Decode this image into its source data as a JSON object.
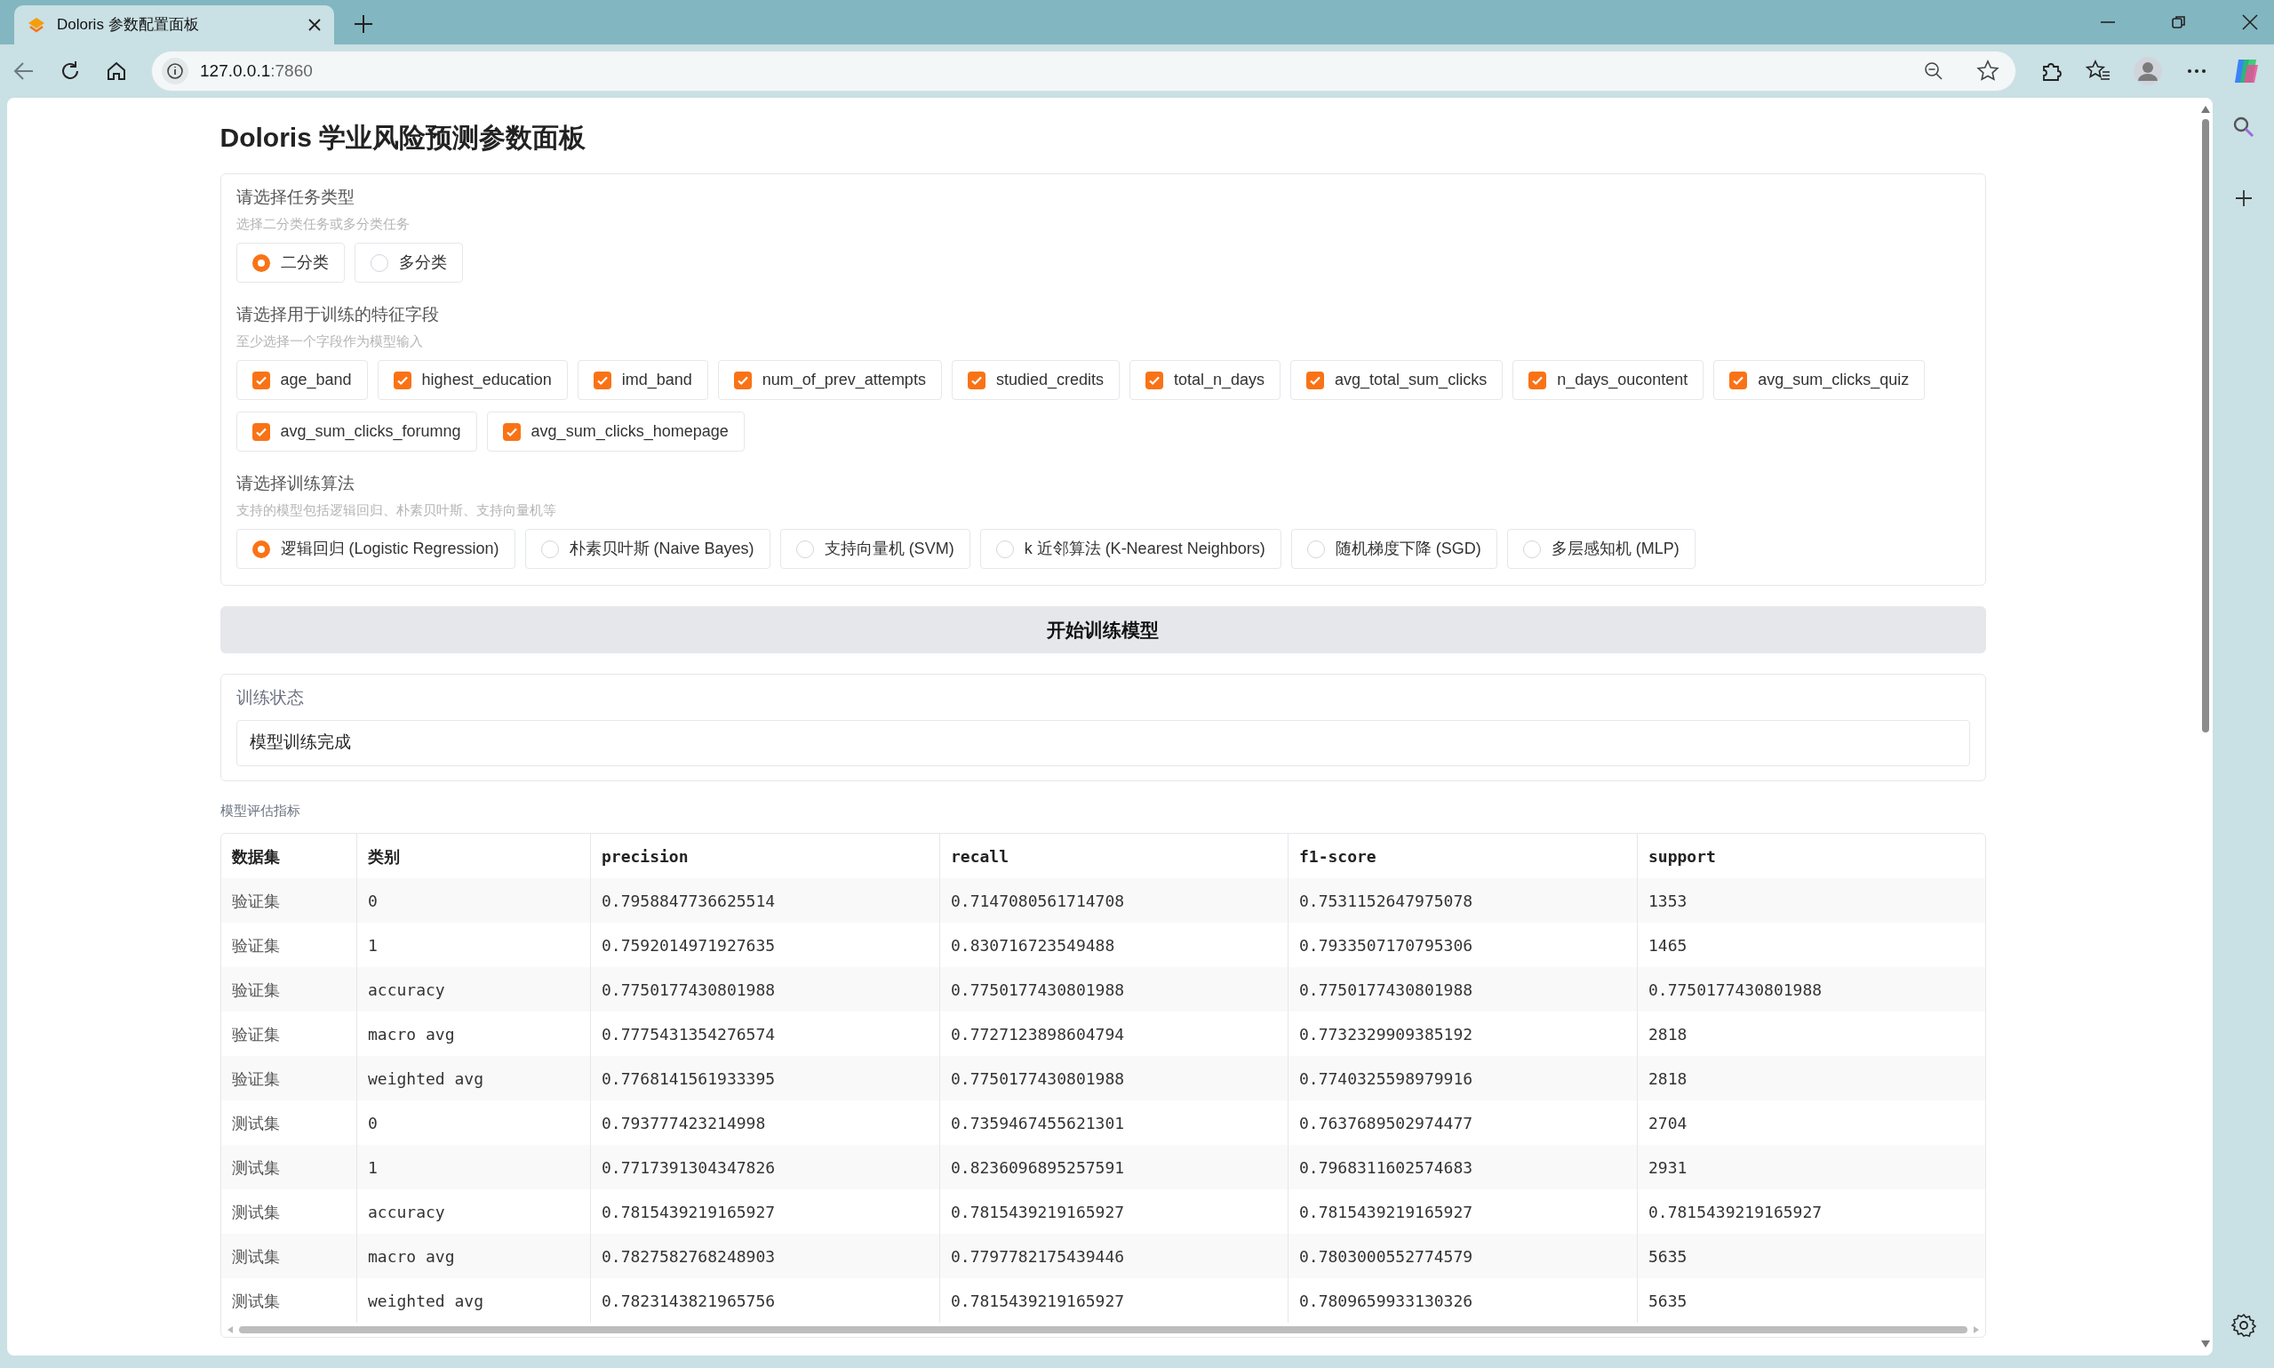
{
  "browser": {
    "tab": {
      "title": "Doloris 参数配置面板",
      "selected": true
    },
    "address": {
      "host": "127.0.0.1",
      "port": ":7860"
    }
  },
  "title": "Doloris 学业风险预测参数面板",
  "form": {
    "sections": [
      {
        "kind": "radio",
        "label": "请选择任务类型",
        "hint": "选择二分类任务或多分类任务",
        "options": [
          {
            "label": "二分类",
            "selected": true
          },
          {
            "label": "多分类",
            "selected": false
          }
        ]
      },
      {
        "kind": "checkbox",
        "label": "请选择用于训练的特征字段",
        "hint": "至少选择一个字段作为模型输入",
        "options": [
          {
            "label": "age_band",
            "checked": true
          },
          {
            "label": "highest_education",
            "checked": true
          },
          {
            "label": "imd_band",
            "checked": true
          },
          {
            "label": "num_of_prev_attempts",
            "checked": true
          },
          {
            "label": "studied_credits",
            "checked": true
          },
          {
            "label": "total_n_days",
            "checked": true
          },
          {
            "label": "avg_total_sum_clicks",
            "checked": true
          },
          {
            "label": "n_days_oucontent",
            "checked": true
          },
          {
            "label": "avg_sum_clicks_quiz",
            "checked": true
          },
          {
            "label": "avg_sum_clicks_forumng",
            "checked": true
          },
          {
            "label": "avg_sum_clicks_homepage",
            "checked": true
          }
        ]
      },
      {
        "kind": "radio",
        "label": "请选择训练算法",
        "hint": "支持的模型包括逻辑回归、朴素贝叶斯、支持向量机等",
        "options": [
          {
            "label": "逻辑回归 (Logistic Regression)",
            "selected": true
          },
          {
            "label": "朴素贝叶斯 (Naive Bayes)",
            "selected": false
          },
          {
            "label": "支持向量机 (SVM)",
            "selected": false
          },
          {
            "label": "k 近邻算法 (K-Nearest Neighbors)",
            "selected": false
          },
          {
            "label": "随机梯度下降 (SGD)",
            "selected": false
          },
          {
            "label": "多层感知机 (MLP)",
            "selected": false
          }
        ]
      }
    ]
  },
  "train_button": "开始训练模型",
  "status": {
    "label": "训练状态",
    "value": "模型训练完成"
  },
  "metrics": {
    "label": "模型评估指标",
    "columns": [
      "数据集",
      "类别",
      "precision",
      "recall",
      "f1-score",
      "support"
    ],
    "rows": [
      [
        "验证集",
        "0",
        "0.7958847736625514",
        "0.7147080561714708",
        "0.7531152647975078",
        "1353"
      ],
      [
        "验证集",
        "1",
        "0.7592014971927635",
        "0.830716723549488",
        "0.7933507170795306",
        "1465"
      ],
      [
        "验证集",
        "accuracy",
        "0.7750177430801988",
        "0.7750177430801988",
        "0.7750177430801988",
        "0.7750177430801988"
      ],
      [
        "验证集",
        "macro avg",
        "0.7775431354276574",
        "0.7727123898604794",
        "0.7732329909385192",
        "2818"
      ],
      [
        "验证集",
        "weighted avg",
        "0.7768141561933395",
        "0.7750177430801988",
        "0.7740325598979916",
        "2818"
      ],
      [
        "测试集",
        "0",
        "0.793777423214998",
        "0.7359467455621301",
        "0.7637689502974477",
        "2704"
      ],
      [
        "测试集",
        "1",
        "0.7717391304347826",
        "0.8236096895257591",
        "0.7968311602574683",
        "2931"
      ],
      [
        "测试集",
        "accuracy",
        "0.7815439219165927",
        "0.7815439219165927",
        "0.7815439219165927",
        "0.7815439219165927"
      ],
      [
        "测试集",
        "macro avg",
        "0.7827582768248903",
        "0.7797782175439446",
        "0.7803000552774579",
        "5635"
      ],
      [
        "测试集",
        "weighted avg",
        "0.7823143821965756",
        "0.7815439219165927",
        "0.7809659933130326",
        "5635"
      ]
    ]
  }
}
